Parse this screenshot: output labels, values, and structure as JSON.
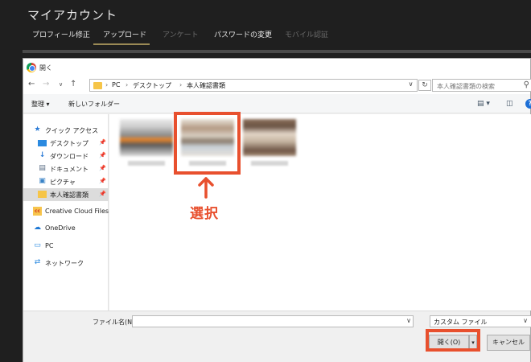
{
  "site": {
    "title": "マイアカウント",
    "tabs": [
      {
        "label": "プロフィール修正"
      },
      {
        "label": "アップロード"
      },
      {
        "label": "アンケート"
      },
      {
        "label": "パスワードの変更"
      },
      {
        "label": "モバイル認証"
      }
    ]
  },
  "dialog": {
    "title": "開く",
    "breadcrumb": [
      "PC",
      "デスクトップ",
      "本人確認書類"
    ],
    "search_placeholder": "本人確認書類の検索",
    "toolbar": {
      "organize": "整理 ▾",
      "new_folder": "新しいフォルダー"
    },
    "sidebar": [
      {
        "label": "クイック アクセス",
        "icon": "star-icon"
      },
      {
        "label": "デスクトップ",
        "icon": "desktop-icon",
        "pinned": true
      },
      {
        "label": "ダウンロード",
        "icon": "download-icon",
        "pinned": true
      },
      {
        "label": "ドキュメント",
        "icon": "document-icon",
        "pinned": true
      },
      {
        "label": "ピクチャ",
        "icon": "pictures-icon",
        "pinned": true
      },
      {
        "label": "本人確認書類",
        "icon": "folder-icon",
        "pinned": true,
        "selected": true
      },
      {
        "label": "Creative Cloud Files",
        "icon": "creative-cloud-icon"
      },
      {
        "label": "OneDrive",
        "icon": "onedrive-icon"
      },
      {
        "label": "PC",
        "icon": "pc-icon"
      },
      {
        "label": "ネットワーク",
        "icon": "network-icon"
      }
    ],
    "footer": {
      "filename_label": "ファイル名(N):",
      "filename_value": "",
      "filetype": "カスタム ファイル",
      "open_label": "開く(O)",
      "cancel_label": "キャンセル"
    }
  },
  "annotation": {
    "label": "選択",
    "color": "#e8502e"
  }
}
